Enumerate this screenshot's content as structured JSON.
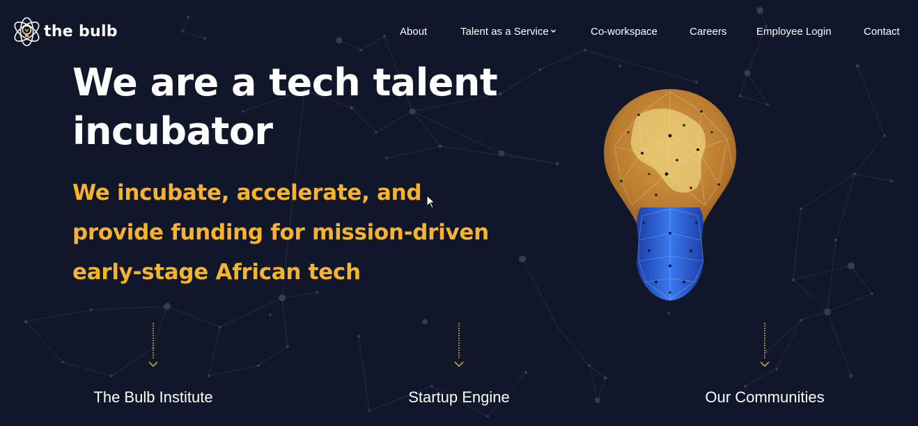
{
  "header": {
    "logo_text": "the bulb",
    "nav": [
      {
        "label": "About"
      },
      {
        "label": "Talent as a Service",
        "has_dropdown": true
      },
      {
        "label": "Co-workspace"
      },
      {
        "label": "Careers"
      },
      {
        "label": "Employee Login"
      },
      {
        "label": "Contact"
      }
    ]
  },
  "hero": {
    "title_line1": "We are a tech talent",
    "title_line2": "incubator",
    "subtitle_line1": "We incubate, accelerate, and",
    "subtitle_line2": "provide funding for mission-driven",
    "subtitle_line3": "early-stage African tech"
  },
  "sections": [
    {
      "label": "The Bulb Institute"
    },
    {
      "label": "Startup Engine"
    },
    {
      "label": "Our Communities"
    }
  ],
  "colors": {
    "background": "#10172b",
    "accent": "#f7b32b",
    "text": "#ffffff",
    "bulb_glass": "#d7953b",
    "bulb_base": "#2a5fd6"
  },
  "icons": {
    "logo": "bulb-logo-icon",
    "dropdown": "chevron-down-icon",
    "scroll": "arrow-down-icon"
  }
}
